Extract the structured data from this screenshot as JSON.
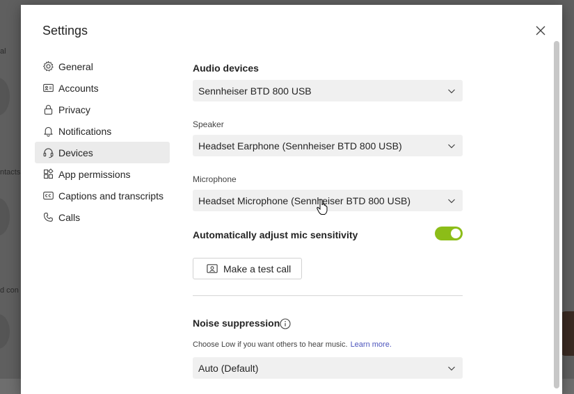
{
  "background": {
    "fragments": [
      "al",
      "ntacts",
      "d con"
    ]
  },
  "dialog": {
    "title": "Settings",
    "close_icon": "close-icon"
  },
  "sidebar": {
    "items": [
      {
        "label": "General",
        "icon": "gear-icon",
        "active": false
      },
      {
        "label": "Accounts",
        "icon": "id-card-icon",
        "active": false
      },
      {
        "label": "Privacy",
        "icon": "lock-icon",
        "active": false
      },
      {
        "label": "Notifications",
        "icon": "bell-icon",
        "active": false
      },
      {
        "label": "Devices",
        "icon": "headset-icon",
        "active": true
      },
      {
        "label": "App permissions",
        "icon": "app-grid-icon",
        "active": false
      },
      {
        "label": "Captions and transcripts",
        "icon": "cc-icon",
        "active": false
      },
      {
        "label": "Calls",
        "icon": "phone-icon",
        "active": false
      }
    ]
  },
  "devices": {
    "audio_heading": "Audio devices",
    "audio_device": "Sennheiser BTD 800 USB",
    "speaker_label": "Speaker",
    "speaker_value": "Headset Earphone (Sennheiser BTD 800 USB)",
    "microphone_label": "Microphone",
    "microphone_value": "Headset Microphone (Sennheiser BTD 800 USB)",
    "auto_adjust_label": "Automatically adjust mic sensitivity",
    "auto_adjust_on": true,
    "test_call_label": "Make a test call",
    "noise_heading": "Noise suppression",
    "noise_hint": "Choose Low if you want others to hear music.",
    "learn_more": "Learn more.",
    "noise_value": "Auto (Default)"
  },
  "colors": {
    "toggle_on": "#8cbd18",
    "link": "#4b53bc",
    "active_nav_bg": "#ebebeb"
  }
}
